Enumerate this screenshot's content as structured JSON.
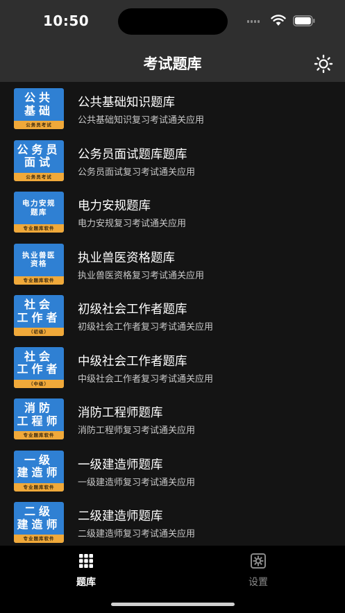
{
  "status_bar": {
    "time": "10:50"
  },
  "header": {
    "title": "考试题库",
    "theme_icon": "sun-icon"
  },
  "items": [
    {
      "title": "公共基础知识题库",
      "subtitle": "公共基础知识复习考试通关应用",
      "icon_text": "公共\n基础",
      "icon_size": "big",
      "icon_band": "公务员考试"
    },
    {
      "title": "公务员面试题库题库",
      "subtitle": "公务员面试复习考试通关应用",
      "icon_text": "公务员\n面试",
      "icon_size": "big",
      "icon_band": "公务员考试"
    },
    {
      "title": "电力安规题库",
      "subtitle": "电力安规复习考试通关应用",
      "icon_text": "电力安规\n题库",
      "icon_size": "small",
      "icon_band": "专业题库软件"
    },
    {
      "title": "执业兽医资格题库",
      "subtitle": "执业兽医资格复习考试通关应用",
      "icon_text": "执业兽医\n资格",
      "icon_size": "small",
      "icon_band": "专业题库软件"
    },
    {
      "title": "初级社会工作者题库",
      "subtitle": "初级社会工作者复习考试通关应用",
      "icon_text": "社会\n工作者",
      "icon_size": "big",
      "icon_band": "（初级）"
    },
    {
      "title": "中级社会工作者题库",
      "subtitle": "中级社会工作者复习考试通关应用",
      "icon_text": "社会\n工作者",
      "icon_size": "big",
      "icon_band": "（中级）"
    },
    {
      "title": "消防工程师题库",
      "subtitle": "消防工程师复习考试通关应用",
      "icon_text": "消防\n工程师",
      "icon_size": "big",
      "icon_band": "专业题库软件"
    },
    {
      "title": "一级建造师题库",
      "subtitle": "一级建造师复习考试通关应用",
      "icon_text": "一级\n建造师",
      "icon_size": "big",
      "icon_band": "专业题库软件"
    },
    {
      "title": "二级建造师题库",
      "subtitle": "二级建造师复习考试通关应用",
      "icon_text": "二级\n建造师",
      "icon_size": "big",
      "icon_band": "专业题库软件"
    }
  ],
  "tabs": [
    {
      "label": "题库",
      "icon": "grid-icon",
      "active": true
    },
    {
      "label": "设置",
      "icon": "settings-icon",
      "active": false
    }
  ],
  "colors": {
    "icon_bg": "#2f80d3",
    "icon_band": "#f0a93a",
    "nav_bg": "#2f2f2f",
    "list_bg": "#141414"
  }
}
